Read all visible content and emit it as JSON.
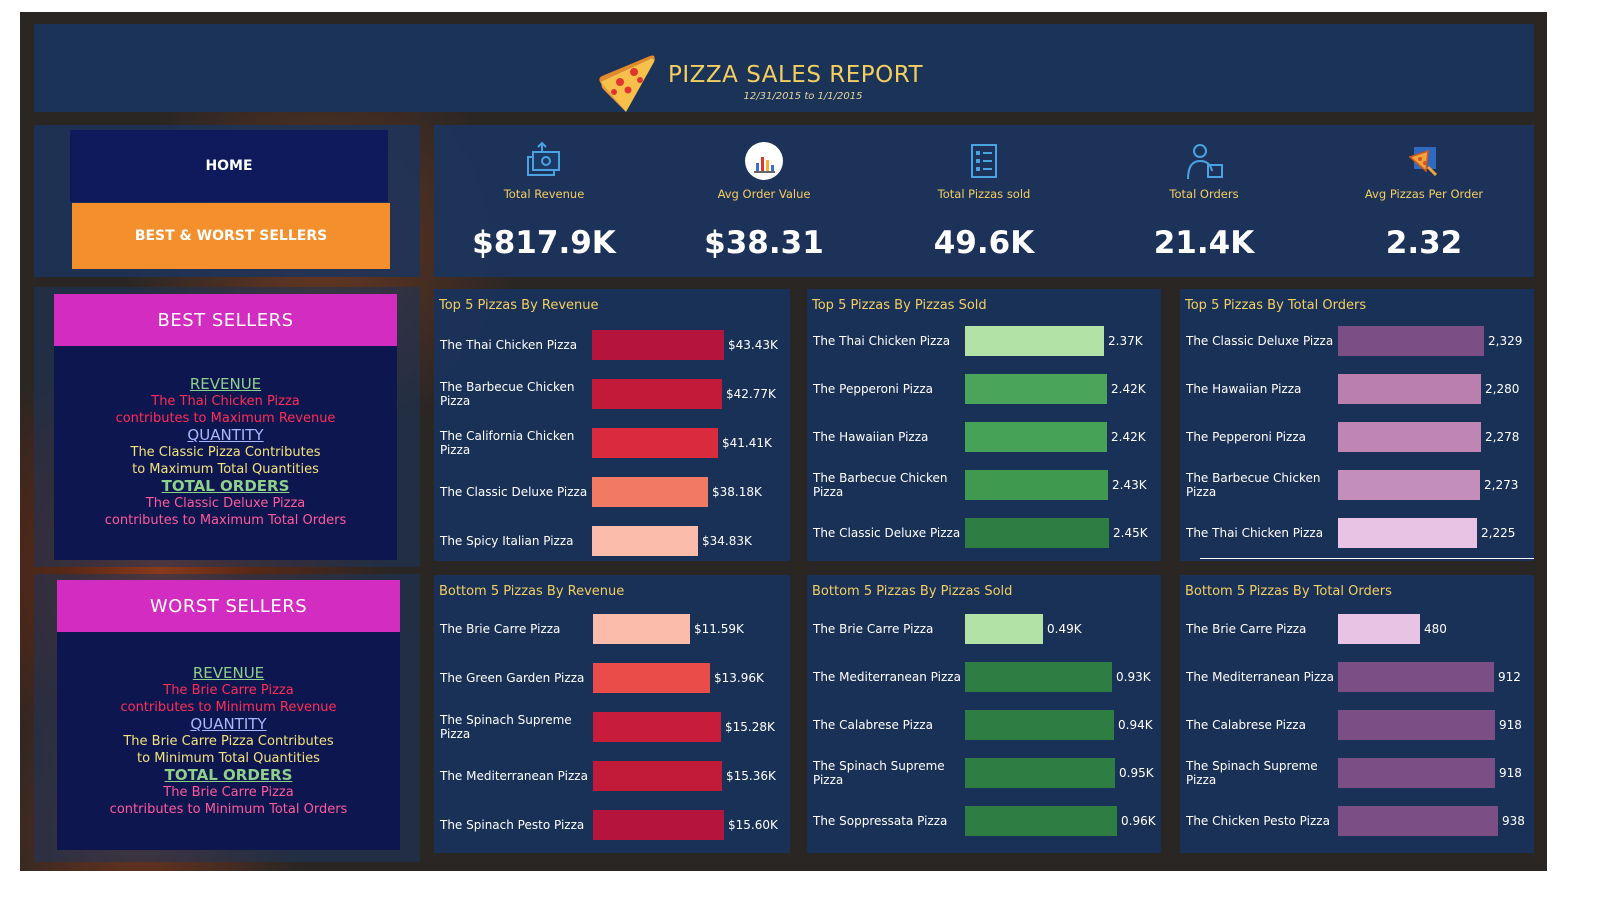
{
  "header": {
    "title": "PIZZA SALES REPORT",
    "date_range": "12/31/2015 to 1/1/2015"
  },
  "nav": {
    "home": "HOME",
    "best_worst": "BEST & WORST SELLERS"
  },
  "kpis": [
    {
      "label": "Total Revenue",
      "value": "$817.9K",
      "icon": "money-transfer-icon"
    },
    {
      "label": "Avg Order Value",
      "value": "$38.31",
      "icon": "chart-report-icon"
    },
    {
      "label": "Total Pizzas sold",
      "value": "49.6K",
      "icon": "checklist-icon"
    },
    {
      "label": "Total Orders",
      "value": "21.4K",
      "icon": "delivery-person-icon"
    },
    {
      "label": "Avg Pizzas Per Order",
      "value": "2.32",
      "icon": "pizza-box-icon"
    }
  ],
  "best": {
    "heading": "BEST SELLERS",
    "revenue_title": "REVENUE",
    "revenue_line1": "The Thai Chicken Pizza",
    "revenue_line2": "contributes to Maximum Revenue",
    "quantity_title": "QUANTITY",
    "quantity_line1": "The Classic Pizza Contributes",
    "quantity_line2": "to Maximum Total Quantities",
    "orders_title": "TOTAL ORDERS",
    "orders_line1": "The Classic Deluxe Pizza",
    "orders_line2": "contributes to Maximum Total Orders"
  },
  "worst": {
    "heading": "WORST SELLERS",
    "revenue_title": "REVENUE",
    "revenue_line1": "The Brie Carre Pizza",
    "revenue_line2": "contributes to Minimum Revenue",
    "quantity_title": "QUANTITY",
    "quantity_line1": "The Brie Carre Pizza Contributes",
    "quantity_line2": "to Minimum Total Quantities",
    "orders_title": "TOTAL ORDERS",
    "orders_line1": "The Brie Carre Pizza",
    "orders_line2": "contributes to Minimum Total Orders"
  },
  "colors": {
    "accent": "#f3cf62",
    "magenta": "#d22cc0",
    "orange": "#f38f2c",
    "navy": "#0e1650"
  },
  "chart_data": [
    {
      "type": "bar",
      "orientation": "horizontal",
      "title": "Top 5 Pizzas By Revenue",
      "categories": [
        "The Thai Chicken Pizza",
        "The Barbecue Chicken Pizza",
        "The California Chicken Pizza",
        "The Classic Deluxe Pizza",
        "The Spicy Italian Pizza"
      ],
      "values": [
        43430,
        42770,
        41410,
        38180,
        34830
      ],
      "labels": [
        "$43.43K",
        "$42.77K",
        "$41.41K",
        "$38.18K",
        "$34.83K"
      ],
      "colors": [
        "#b5153c",
        "#c41a3a",
        "#d92b3d",
        "#f27a62",
        "#fcbcac"
      ],
      "xlim": [
        0,
        43430
      ]
    },
    {
      "type": "bar",
      "orientation": "horizontal",
      "title": "Top 5 Pizzas By Pizzas Sold",
      "categories": [
        "The Thai Chicken Pizza",
        "The Pepperoni Pizza",
        "The Hawaiian Pizza",
        "The Barbecue Chicken Pizza",
        "The Classic Deluxe Pizza"
      ],
      "values": [
        2.37,
        2.42,
        2.42,
        2.43,
        2.45
      ],
      "labels": [
        "2.37K",
        "2.42K",
        "2.42K",
        "2.43K",
        "2.45K"
      ],
      "colors": [
        "#b2e2a6",
        "#4aa55a",
        "#46a256",
        "#3f9a50",
        "#2e7d43"
      ],
      "xlim": [
        0,
        2.45
      ]
    },
    {
      "type": "bar",
      "orientation": "horizontal",
      "title": "Top 5 Pizzas By Total Orders",
      "categories": [
        "The Classic Deluxe Pizza",
        "The Hawaiian Pizza",
        "The Pepperoni Pizza",
        "The Barbecue Chicken Pizza",
        "The Thai Chicken Pizza"
      ],
      "values": [
        2329,
        2280,
        2278,
        2273,
        2225
      ],
      "labels": [
        "2,329",
        "2,280",
        "2,278",
        "2,273",
        "2,225"
      ],
      "colors": [
        "#7b4f85",
        "#bb7fae",
        "#bf85b3",
        "#c48ebb",
        "#e9c3e4"
      ],
      "xlim": [
        0,
        2329
      ]
    },
    {
      "type": "bar",
      "orientation": "horizontal",
      "title": "Bottom 5 Pizzas By Revenue",
      "categories": [
        "The Brie Carre Pizza",
        "The Green Garden Pizza",
        "The Spinach Supreme Pizza",
        "The Mediterranean Pizza",
        "The Spinach Pesto Pizza"
      ],
      "values": [
        11590,
        13960,
        15280,
        15360,
        15600
      ],
      "labels": [
        "$11.59K",
        "$13.96K",
        "$15.28K",
        "$15.36K",
        "$15.60K"
      ],
      "colors": [
        "#fcbcac",
        "#ea4c4a",
        "#c81d3a",
        "#c21b3a",
        "#b5153c"
      ],
      "xlim": [
        0,
        15600
      ]
    },
    {
      "type": "bar",
      "orientation": "horizontal",
      "title": "Bottom 5 Pizzas By Pizzas Sold",
      "categories": [
        "The Brie Carre Pizza",
        "The Mediterranean Pizza",
        "The Calabrese Pizza",
        "The Spinach Supreme Pizza",
        "The Soppressata Pizza"
      ],
      "values": [
        0.49,
        0.93,
        0.94,
        0.95,
        0.96
      ],
      "labels": [
        "0.49K",
        "0.93K",
        "0.94K",
        "0.95K",
        "0.96K"
      ],
      "colors": [
        "#b2e2a6",
        "#2e7d43",
        "#2e7d43",
        "#2e7d43",
        "#2e7d43"
      ],
      "xlim": [
        0,
        0.96
      ]
    },
    {
      "type": "bar",
      "orientation": "horizontal",
      "title": "Bottom 5 Pizzas By Total Orders",
      "categories": [
        "The Brie Carre Pizza",
        "The Mediterranean Pizza",
        "The Calabrese Pizza",
        "The Spinach Supreme Pizza",
        "The Chicken Pesto Pizza"
      ],
      "values": [
        480,
        912,
        918,
        918,
        938
      ],
      "labels": [
        "480",
        "912",
        "918",
        "918",
        "938"
      ],
      "colors": [
        "#e9c3e4",
        "#7b4f85",
        "#7b4f85",
        "#7b4f85",
        "#7b4f85"
      ],
      "xlim": [
        0,
        938
      ]
    }
  ]
}
